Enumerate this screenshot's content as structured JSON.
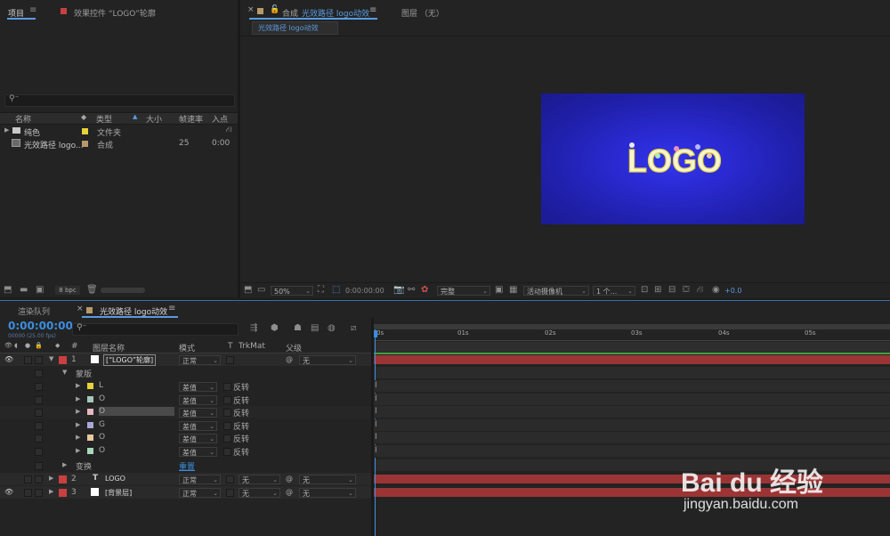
{
  "project_panel": {
    "tab_project": "项目",
    "tab_effects": "效果控件 “LOGO”轮廓",
    "search_icon": "search-icon",
    "columns": [
      "名称",
      "类型",
      "大小",
      "帧速率",
      "入点"
    ],
    "items": [
      {
        "name": "纯色",
        "type": "文件夹",
        "fps": "",
        "in": "",
        "color": "#e8d23a"
      },
      {
        "name": "光效路径 logo...",
        "type": "合成",
        "fps": "25",
        "in": "0:00",
        "color": "#b79a6a"
      }
    ],
    "bpc": "8 bpc"
  },
  "comp_panel": {
    "tab_label": "合成",
    "comp_name": "光效路径 logo动效",
    "layer_tab": "图层 （无）",
    "breadcrumb": "光效路径 logo动效",
    "logo_text": "LOGO",
    "zoom": "50%",
    "timecode": "0:00:00:00",
    "quality": "完整",
    "camera": "活动摄像机",
    "views": "1 个...",
    "exposure": "+0.0"
  },
  "timeline": {
    "tab_render": "渲染队列",
    "tab_comp": "光效路径 logo动效",
    "timecode": "0:00:00:00",
    "frame_info": "00000 (25.00 fps)",
    "headers": {
      "num": "#",
      "layer_name": "图层名称",
      "mode": "模式",
      "t": "T",
      "trkmat": "TrkMat",
      "parent": "父级"
    },
    "ruler": [
      "0s",
      "01s",
      "02s",
      "03s",
      "04s",
      "05s"
    ],
    "layers": [
      {
        "num": "1",
        "name": "[“LOGO”轮廓]",
        "mode": "正常",
        "parent": "无",
        "color": "#c84040",
        "swatch": "#ffffff"
      },
      {
        "num": "2",
        "name": "LOGO",
        "mode": "正常",
        "trkmat": "无",
        "parent": "无",
        "color": "#c84040"
      },
      {
        "num": "3",
        "name": "[背景层]",
        "mode": "正常",
        "trkmat": "无",
        "parent": "无",
        "color": "#c84040",
        "swatch": "#ffffff"
      }
    ],
    "masks_label": "蒙版",
    "masks": [
      {
        "name": "L",
        "mode": "差值",
        "invert": "反转",
        "color": "#e8d23a"
      },
      {
        "name": "O",
        "mode": "差值",
        "invert": "反转",
        "color": "#a8c7b8"
      },
      {
        "name": "O",
        "mode": "差值",
        "invert": "反转",
        "color": "#e6b8c0"
      },
      {
        "name": "G",
        "mode": "差值",
        "invert": "反转",
        "color": "#a8a8d8"
      },
      {
        "name": "O",
        "mode": "差值",
        "invert": "反转",
        "color": "#e8c8a0"
      },
      {
        "name": "O",
        "mode": "差值",
        "invert": "反转",
        "color": "#a8d8b8"
      }
    ],
    "transform_label": "变换",
    "reset_label": "重置"
  },
  "watermark": {
    "brand": "Bai du 经验",
    "url": "jingyan.baidu.com"
  }
}
